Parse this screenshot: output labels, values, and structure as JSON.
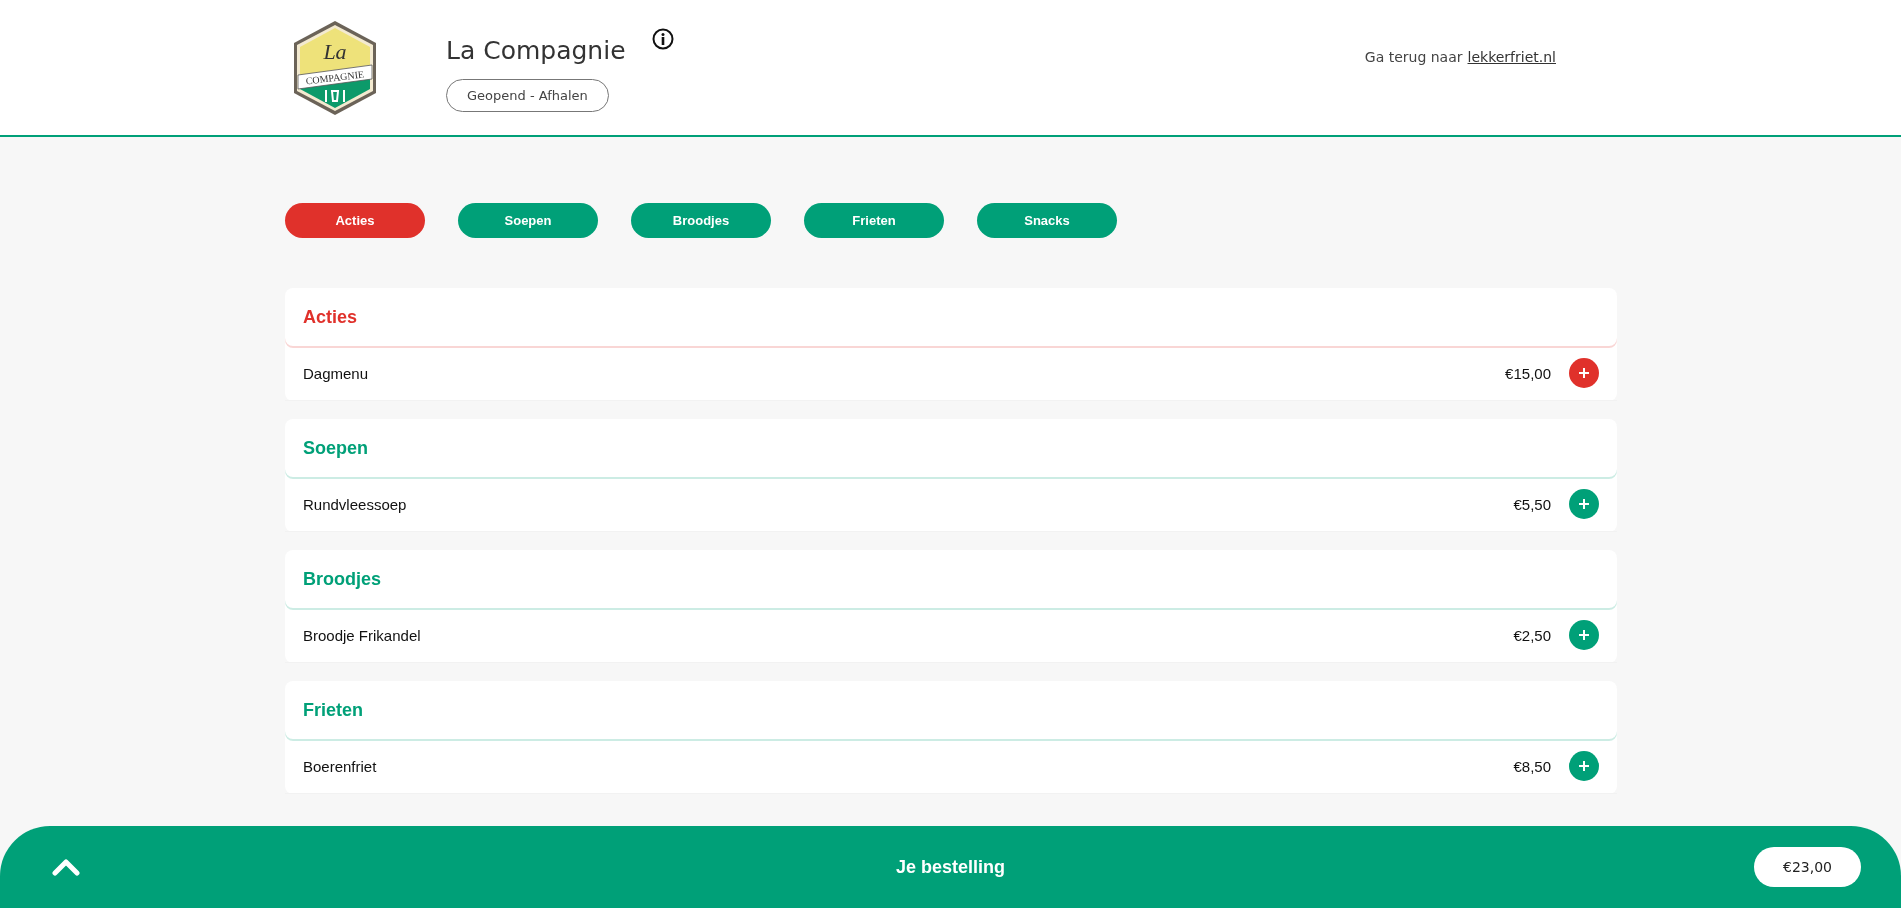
{
  "header": {
    "logo_text": "La",
    "logo_subtitle": "COMPAGNIE",
    "title": "La Compagnie",
    "status": "Geopend - Afhalen",
    "back_text": "Ga terug naar",
    "back_link": "lekkerfriet.nl"
  },
  "tabs": [
    {
      "label": "Acties",
      "color": "#e0312b"
    },
    {
      "label": "Soepen",
      "color": "#00a078"
    },
    {
      "label": "Broodjes",
      "color": "#00a078"
    },
    {
      "label": "Frieten",
      "color": "#00a078"
    },
    {
      "label": "Snacks",
      "color": "#00a078"
    }
  ],
  "sections": [
    {
      "title": "Acties",
      "color": "#e0312b",
      "items": [
        {
          "name": "Dagmenu",
          "price": "€15,00"
        }
      ]
    },
    {
      "title": "Soepen",
      "color": "#00a078",
      "items": [
        {
          "name": "Rundvleessoep",
          "price": "€5,50"
        }
      ]
    },
    {
      "title": "Broodjes",
      "color": "#00a078",
      "items": [
        {
          "name": "Broodje Frikandel",
          "price": "€2,50"
        }
      ]
    },
    {
      "title": "Frieten",
      "color": "#00a078",
      "items": [
        {
          "name": "Boerenfriet",
          "price": "€8,50"
        }
      ]
    }
  ],
  "order_bar": {
    "title": "Je bestelling",
    "total": "€23,00"
  }
}
